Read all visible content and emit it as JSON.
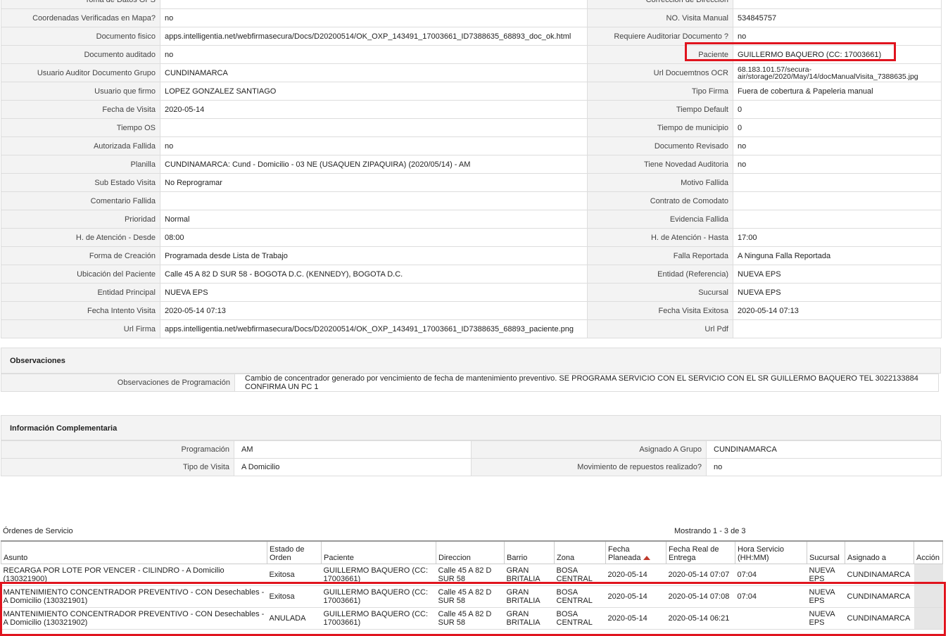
{
  "details": {
    "rows": [
      [
        "Toma de Datos GPS",
        "",
        "Corrección de Dirección",
        ""
      ],
      [
        "Coordenadas Verificadas en Mapa?",
        "no",
        "NO. Visita Manual",
        "534845757"
      ],
      [
        "Documento fisico",
        "apps.intelligentia.net/webfirmasecura/Docs/D20200514/OK_OXP_143491_17003661_ID7388635_68893_doc_ok.html",
        "Requiere Auditoriar Documento ?",
        "no"
      ],
      [
        "Documento auditado",
        "no",
        "Paciente",
        "GUILLERMO BAQUERO (CC: 17003661)"
      ],
      [
        "Usuario Auditor Documento Grupo",
        " CUNDINAMARCA",
        "Url Docuemtnos OCR",
        " 68.183.101.57/secura-air/storage/2020/May/14/docManualVisita_7388635.jpg"
      ],
      [
        "Usuario que firmo",
        "LOPEZ GONZALEZ SANTIAGO",
        "Tipo Firma",
        " Fuera de cobertura & Papeleria manual"
      ],
      [
        "Fecha de Visita",
        "2020-05-14",
        "Tiempo Default",
        " 0"
      ],
      [
        "Tiempo OS",
        "",
        "Tiempo de municipio",
        " 0"
      ],
      [
        "Autorizada Fallida",
        "no",
        "Documento Revisado",
        "no"
      ],
      [
        "Planilla",
        "CUNDINAMARCA: Cund - Domicilio - 03 NE (USAQUEN ZIPAQUIRA) (2020/05/14) - AM",
        "Tiene Novedad Auditoria",
        "no"
      ],
      [
        "Sub Estado Visita",
        " No Reprogramar",
        "Motivo Fallida",
        ""
      ],
      [
        "Comentario Fallida",
        "",
        "Contrato de Comodato",
        ""
      ],
      [
        "Prioridad",
        " Normal",
        "Evidencia Fallida",
        ""
      ],
      [
        "H. de Atención - Desde",
        " 08:00",
        "H. de Atención - Hasta",
        " 17:00"
      ],
      [
        "Forma de Creación",
        " Programada desde Lista de Trabajo",
        "Falla Reportada",
        " A Ninguna Falla Reportada"
      ],
      [
        "Ubicación del Paciente",
        "Calle 45 A 82 D SUR 58 - BOGOTA D.C. (KENNEDY), BOGOTA D.C.",
        "Entidad (Referencia)",
        "NUEVA EPS"
      ],
      [
        "Entidad Principal",
        " NUEVA EPS",
        "Sucursal",
        " NUEVA EPS"
      ],
      [
        "Fecha Intento Visita",
        "2020-05-14 07:13",
        "Fecha Visita Exitosa",
        "2020-05-14 07:13"
      ],
      [
        "Url Firma",
        " apps.intelligentia.net/webfirmasecura/Docs/D20200514/OK_OXP_143491_17003661_ID7388635_68893_paciente.png",
        "Url Pdf",
        ""
      ]
    ]
  },
  "observaciones": {
    "title": "Observaciones",
    "label": "Observaciones de Programación",
    "text": "Cambio de concentrador generado por vencimiento de fecha de mantenimiento preventivo. SE PROGRAMA SERVICIO CON EL SERVICIO CON EL SR GUILLERMO BAQUERO TEL 3022133884 CONFIRMA UN PC 1"
  },
  "complementaria": {
    "title": "Información Complementaria",
    "rows": [
      [
        "Programación",
        "AM",
        "Asignado A Grupo",
        "CUNDINAMARCA"
      ],
      [
        "Tipo de Visita",
        "A Domicilio",
        "Movimiento de repuestos realizado?",
        "no"
      ]
    ]
  },
  "ordenes": {
    "title": "Órdenes de Servicio",
    "showing": "Mostrando 1 - 3 de 3",
    "headers": [
      "Asunto",
      "Estado de Orden",
      "Paciente",
      "Direccion",
      "Barrio",
      "Zona",
      "Fecha Planeada",
      "Fecha Real de Entrega",
      "Hora Servicio (HH:MM)",
      "Sucursal",
      "Asignado a",
      "Acción"
    ],
    "rows": [
      [
        "RECARGA POR LOTE POR VENCER - CILINDRO - A Domicilio (130321900)",
        "Exitosa",
        "GUILLERMO BAQUERO (CC: 17003661)",
        "Calle 45 A 82 D SUR 58",
        "GRAN BRITALIA",
        "BOSA CENTRAL",
        "2020-05-14",
        "2020-05-14 07:07",
        "07:04",
        "NUEVA EPS",
        "CUNDINAMARCA",
        ""
      ],
      [
        "MANTENIMIENTO CONCENTRADOR PREVENTIVO - CON Desechables - A Domicilio (130321901)",
        "Exitosa",
        "GUILLERMO BAQUERO (CC: 17003661)",
        "Calle 45 A 82 D SUR 58",
        "GRAN BRITALIA",
        "BOSA CENTRAL",
        "2020-05-14",
        "2020-05-14 07:08",
        "07:04",
        "NUEVA EPS",
        "CUNDINAMARCA",
        ""
      ],
      [
        "MANTENIMIENTO CONCENTRADOR PREVENTIVO - CON Desechables - A Domicilio (130321902)",
        "ANULADA",
        "GUILLERMO BAQUERO (CC: 17003661)",
        "Calle 45 A 82 D SUR 58",
        "GRAN BRITALIA",
        "BOSA CENTRAL",
        "2020-05-14",
        "2020-05-14 06:21",
        "",
        "NUEVA EPS",
        "CUNDINAMARCA",
        ""
      ]
    ]
  },
  "colors": {
    "highlight": "#e0141e",
    "label_bg": "#f3f3f3",
    "sort_arrow": "#c0392b"
  },
  "icons": {
    "sort": "sort-ascending-icon"
  }
}
